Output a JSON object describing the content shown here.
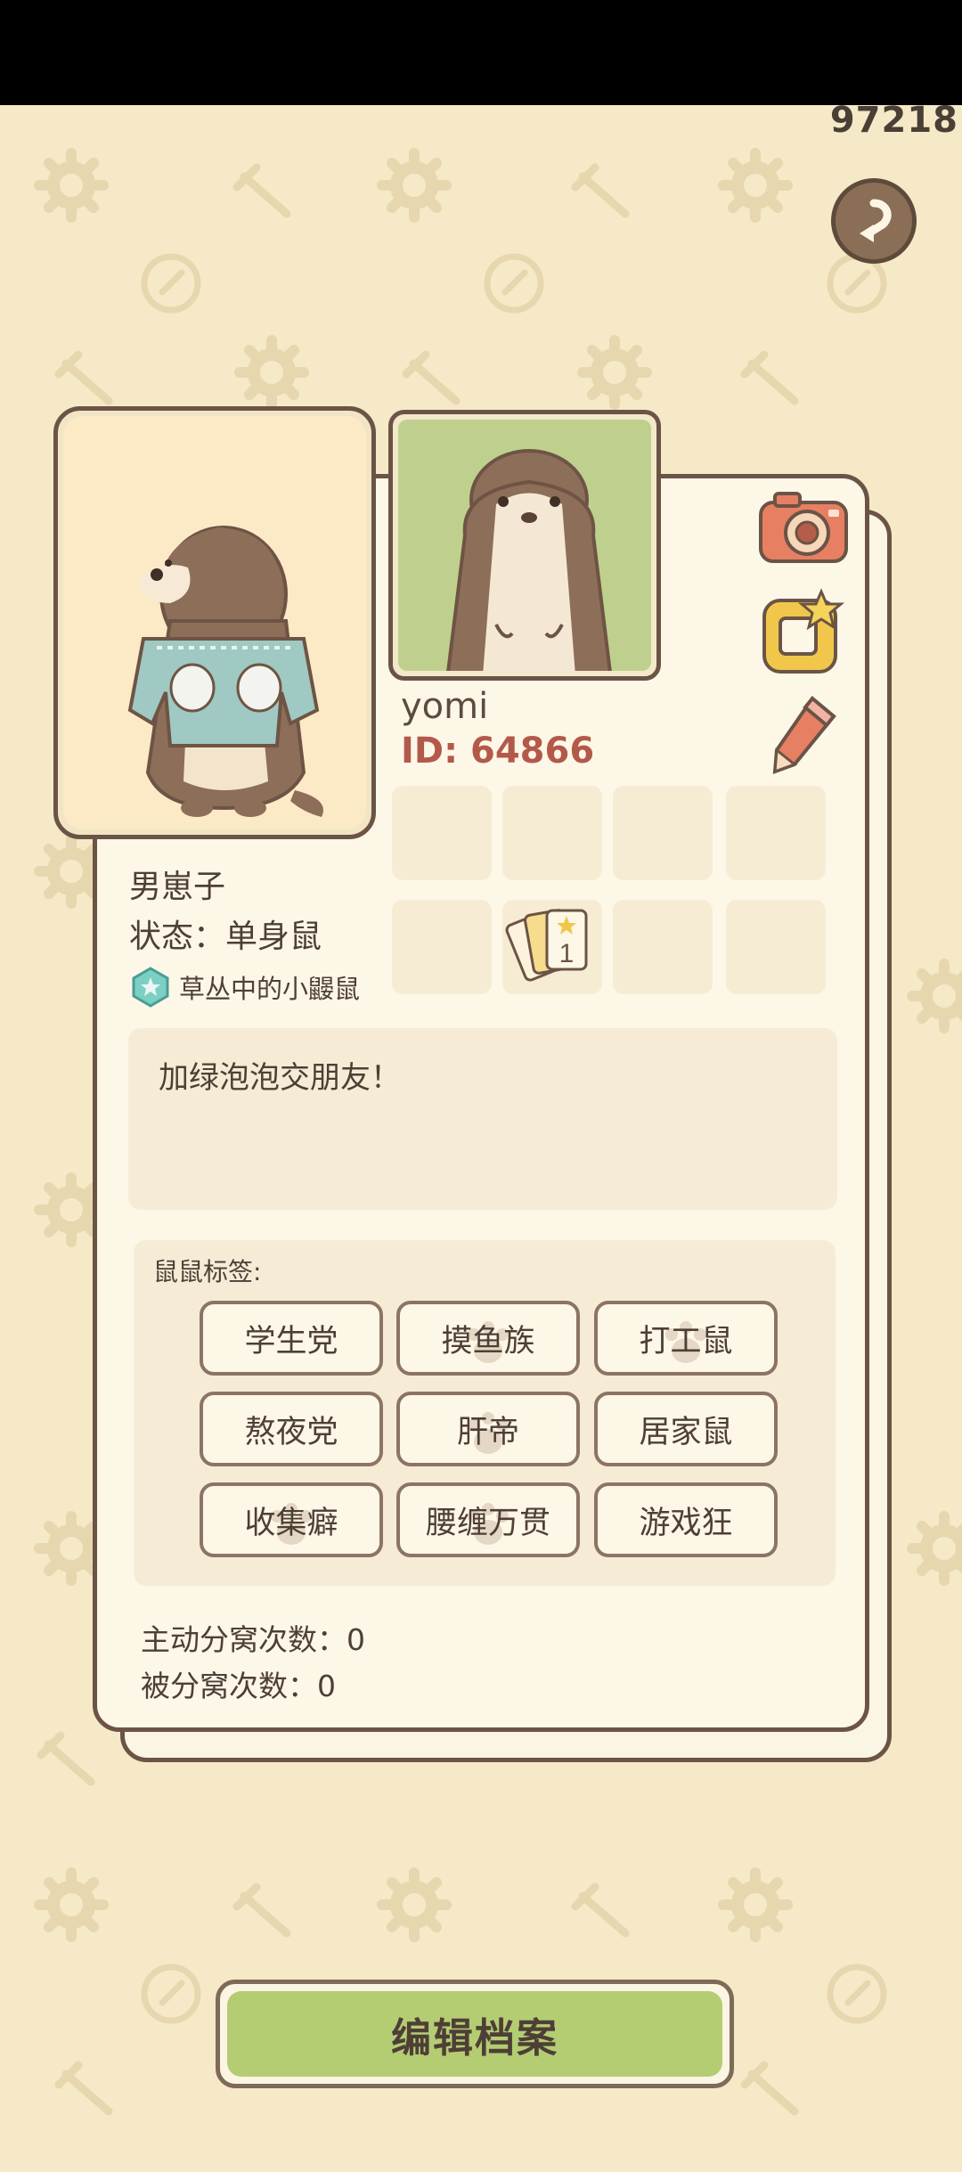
{
  "counter": "97218",
  "profile": {
    "username": "yomi",
    "id_label": "ID: 64866",
    "gender": "男崽子",
    "status": "状态：单身鼠",
    "badge": "草丛中的小鼹鼠",
    "motto": "加绿泡泡交朋友！"
  },
  "tags": {
    "title": "鼠鼠标签:",
    "items": [
      "学生党",
      "摸鱼族",
      "打工鼠",
      "熬夜党",
      "肝帝",
      "居家鼠",
      "收集癖",
      "腰缠万贯",
      "游戏狂"
    ]
  },
  "stats": {
    "active_breakups": "主动分窝次数：0",
    "passive_breakups": "被分窝次数：0"
  },
  "edit_button": "编辑档案",
  "icons": {
    "back": "back-arrow-icon",
    "camera": "camera-icon",
    "frame": "frame-star-icon",
    "pencil": "pencil-icon",
    "cards": "cards-icon"
  }
}
